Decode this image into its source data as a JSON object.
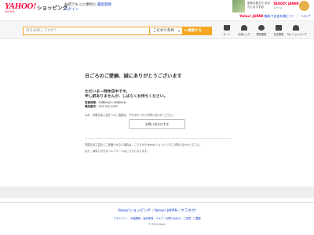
{
  "header": {
    "logo_text": "YAHOO!",
    "logo_sub": "JAPAN",
    "service_name": "ショッピング",
    "promo_text": "お得でもっと便利に",
    "promo_link": "最高登録",
    "login_label": "ログイン",
    "ad_text": "週末の旅立ち あなたにおすすめ",
    "ad_brand": "YAHOO! JAPAN",
    "ad_sub": "トラベル",
    "toplinks_brand": "Yahoo! JAPAN",
    "toplinks_text": "無料でお店を開こう！",
    "toplinks_help": "ヘルプ"
  },
  "search": {
    "placeholder": "何をお探しですか？",
    "filter_label": "こだわり条件",
    "button_label": "検索する"
  },
  "nav": [
    {
      "icon": "cart-icon",
      "label": "カート"
    },
    {
      "icon": "heart-icon",
      "label": "お気に入り"
    },
    {
      "icon": "clock-icon",
      "label": "閲覧履歴"
    },
    {
      "icon": "box-icon",
      "label": "注文履歴"
    },
    {
      "icon": "person-icon",
      "label": "My ショッピング"
    }
  ],
  "main": {
    "title": "日ごろのご愛顧、誠にありがとうございます",
    "line1": "ただいま一時休店中です。",
    "line2": "申し訳ありませんが、しばらくお待ちください。",
    "hours_label": "営業時間：",
    "hours_value": "00時00分～00時00分",
    "phone_label": "電話番号：",
    "phone_value": "093-351-4032",
    "note": "なお、早屋を高工芸社へのご連絡は、下のボタンからお問い合わせください。",
    "contact_button": "お問い合わせする",
    "foot1": "早屋を高工芸社とご連絡つかない場合は、こちらからYahoo!ショッピングにお問い合わせください。",
    "foot2": "また、最後に対するヘルプページはこちらになります。"
  },
  "footer": {
    "links": [
      "Yahoo!ショッピング",
      "Yahoo! JAPAN",
      "ヤフオク!"
    ],
    "sub": "プライバシー - 利用規約 - 免責事項 - ヘルプ・お問い合わせ - ご意見・ご要望",
    "copyright": "© Yahoo Japan"
  }
}
